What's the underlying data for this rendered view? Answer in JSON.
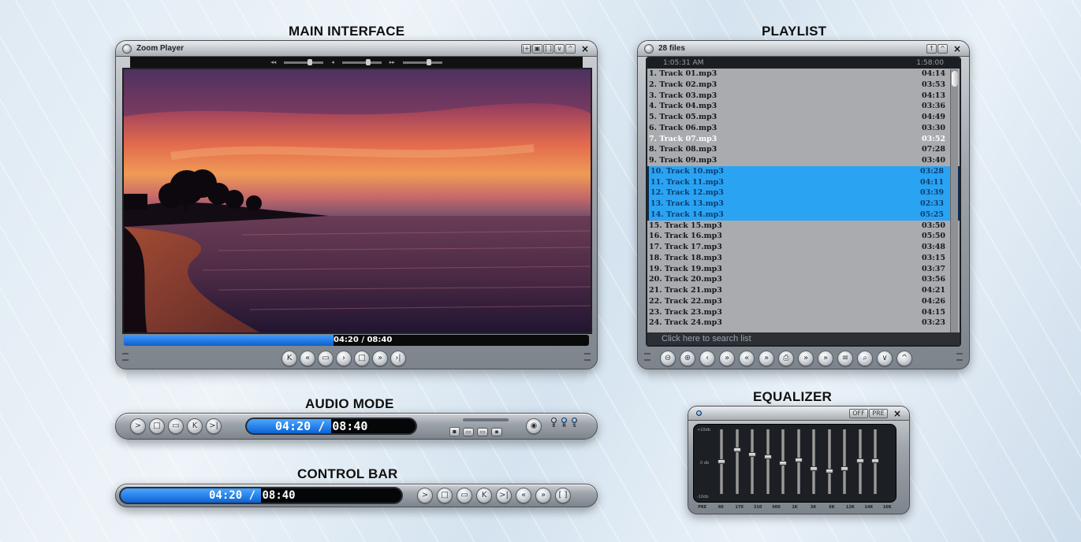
{
  "sections": {
    "main": "MAIN INTERFACE",
    "playlist": "PLAYLIST",
    "audio": "AUDIO MODE",
    "control": "CONTROL BAR",
    "equalizer": "EQUALIZER"
  },
  "main": {
    "window_title": "Zoom Player",
    "title_buttons": [
      "|+|",
      "▣",
      "[ ]",
      "∨",
      "^"
    ],
    "close": "×",
    "elapsed": "04:20",
    "separator": "/",
    "total": "08:40",
    "progress": 0.45,
    "transport": [
      "K",
      "«",
      "▭",
      "›",
      "□",
      "»",
      "›|"
    ]
  },
  "playlist": {
    "title": "28 files",
    "title_buttons": [
      "↑",
      "^"
    ],
    "close": "×",
    "clock": "1:05:31 AM",
    "total_time": "1:58:00",
    "current_index": 6,
    "selected_range": [
      9,
      13
    ],
    "tracks": [
      {
        "name": "1. Track 01.mp3",
        "time": "04:14"
      },
      {
        "name": "2. Track 02.mp3",
        "time": "03:53"
      },
      {
        "name": "3. Track 03.mp3",
        "time": "04:13"
      },
      {
        "name": "4. Track 04.mp3",
        "time": "03:36"
      },
      {
        "name": "5. Track 05.mp3",
        "time": "04:49"
      },
      {
        "name": "6. Track 06.mp3",
        "time": "03:30"
      },
      {
        "name": "7. Track 07.mp3",
        "time": "03:52"
      },
      {
        "name": "8. Track 08.mp3",
        "time": "07:28"
      },
      {
        "name": "9. Track 09.mp3",
        "time": "03:40"
      },
      {
        "name": "10. Track 10.mp3",
        "time": "03:28"
      },
      {
        "name": "11. Track 11.mp3",
        "time": "04:11"
      },
      {
        "name": "12. Track 12.mp3",
        "time": "03:39"
      },
      {
        "name": "13. Track 13.mp3",
        "time": "02:33"
      },
      {
        "name": "14. Track 14.mp3",
        "time": "05:25"
      },
      {
        "name": "15. Track 15.mp3",
        "time": "03:50"
      },
      {
        "name": "16. Track 16.mp3",
        "time": "05:50"
      },
      {
        "name": "17. Track 17.mp3",
        "time": "03:48"
      },
      {
        "name": "18. Track 18.mp3",
        "time": "03:15"
      },
      {
        "name": "19. Track 19.mp3",
        "time": "03:37"
      },
      {
        "name": "20. Track 20.mp3",
        "time": "03:56"
      },
      {
        "name": "21. Track 21.mp3",
        "time": "04:21"
      },
      {
        "name": "22. Track 22.mp3",
        "time": "04:26"
      },
      {
        "name": "23. Track 23.mp3",
        "time": "04:15"
      },
      {
        "name": "24. Track 24.mp3",
        "time": "03:23"
      }
    ],
    "search_placeholder": "Click here to search list",
    "toolbar": [
      "⊖",
      "⊕",
      "‹",
      "»",
      "«",
      "»",
      "⎙",
      "»",
      "»",
      "≡",
      "⌕",
      "∨",
      "^"
    ]
  },
  "audio": {
    "elapsed": "04:20",
    "separator": "/",
    "total": "08:40",
    "progress": 0.5,
    "buttons": [
      ">",
      "□",
      "▭",
      "K",
      ">|"
    ],
    "mode_leds": [
      "E",
      "R",
      "S"
    ]
  },
  "control": {
    "elapsed": "04:20",
    "separator": "/",
    "total": "08:40",
    "progress": 0.5,
    "buttons": [
      ">",
      "□",
      "▭",
      "K",
      ">|",
      "«",
      "»",
      "[ ]"
    ]
  },
  "equalizer": {
    "off_label": "OFF",
    "pre_label": "PRE",
    "close": "×",
    "scale_top": "+10db",
    "scale_mid": "0 db",
    "scale_bottom": "-10db",
    "bands": [
      "PRE",
      "60",
      "170",
      "310",
      "600",
      "1K",
      "3K",
      "6K",
      "12K",
      "14K",
      "16K"
    ],
    "levels": [
      0.5,
      0.3,
      0.38,
      0.42,
      0.52,
      0.48,
      0.62,
      0.66,
      0.62,
      0.49,
      0.49
    ]
  }
}
